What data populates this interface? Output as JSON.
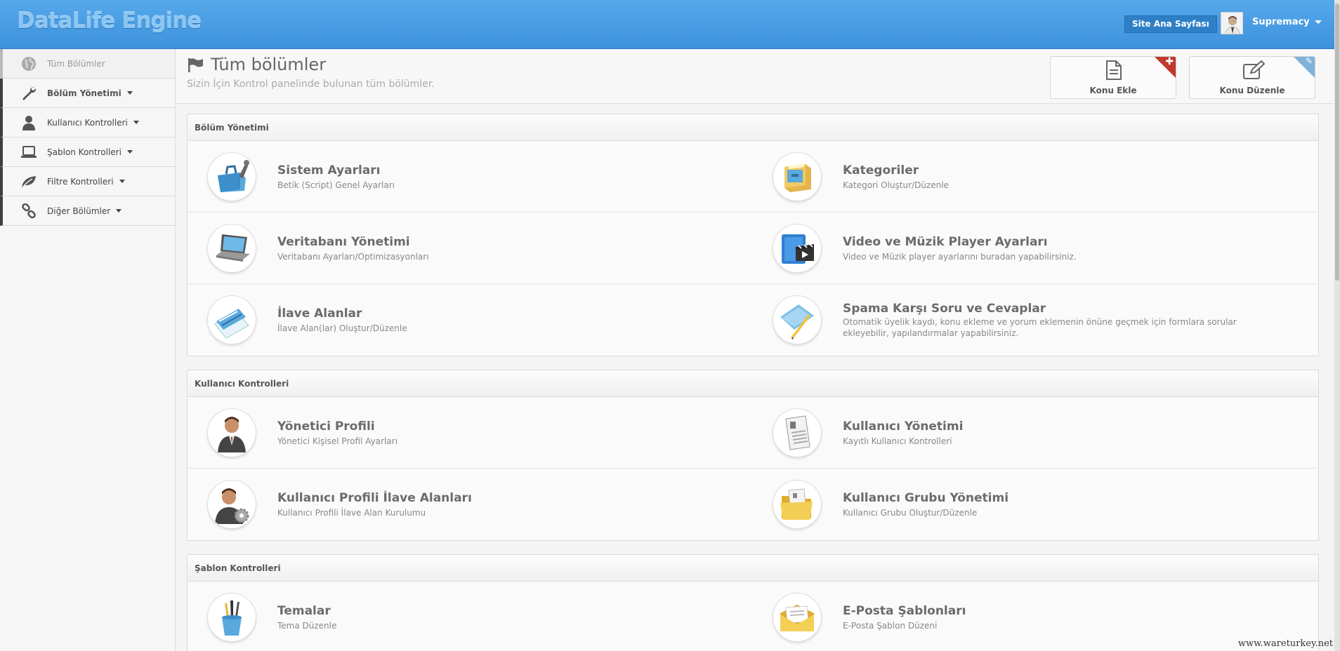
{
  "header": {
    "logo": "DataLife Engine",
    "site_button": "Site Ana Sayfası",
    "user_name": "Supremacy"
  },
  "sidebar": {
    "items": [
      {
        "label": "Tüm Bölümler",
        "icon": "globe-icon",
        "active": true
      },
      {
        "label": "Bölüm Yönetimi",
        "icon": "wrench-icon"
      },
      {
        "label": "Kullanıcı Kontrolleri",
        "icon": "user-icon"
      },
      {
        "label": "Şablon Kontrolleri",
        "icon": "laptop-icon"
      },
      {
        "label": "Filtre Kontrolleri",
        "icon": "leaf-icon"
      },
      {
        "label": "Diğer Bölümler",
        "icon": "link-icon"
      }
    ]
  },
  "page": {
    "title": "Tüm bölümler",
    "subtitle": "Sizin İçin Kontrol panelinde bulunan tüm bölümler."
  },
  "quick_buttons": [
    {
      "label": "Konu Ekle",
      "icon": "document-icon",
      "corner_color": "#c0392b"
    },
    {
      "label": "Konu Düzenle",
      "icon": "edit-icon",
      "corner_color": "#7fb3d9"
    }
  ],
  "panels": [
    {
      "title": "Bölüm Yönetimi",
      "items": [
        {
          "title": "Sistem Ayarları",
          "desc": "Betik (Script) Genel Ayarları",
          "icon": "toolbox-icon"
        },
        {
          "title": "Kategoriler",
          "desc": "Kategori Oluştur/Düzenle",
          "icon": "filing-cabinet-icon"
        },
        {
          "title": "Veritabanı Yönetimi",
          "desc": "Veritabanı Ayarları/Optimizasyonları",
          "icon": "laptop-icon"
        },
        {
          "title": "Video ve Müzik Player Ayarları",
          "desc": "Video ve Müzik player ayarlarını buradan yapabilirsiniz.",
          "icon": "video-icon"
        },
        {
          "title": "İlave Alanlar",
          "desc": "İlave Alan(lar) Oluştur/Düzenle",
          "icon": "ruler-icon"
        },
        {
          "title": "Spama Karşı Soru ve Cevaplar",
          "desc": "Otomatik üyelik kaydı, konu ekleme ve yorum eklemenin önüne geçmek için formlara sorular ekleyebilir, yapılandırmalar yapabilirsiniz.",
          "icon": "paper-pencil-icon"
        }
      ]
    },
    {
      "title": "Kullanıcı Kontrolleri",
      "items": [
        {
          "title": "Yönetici Profili",
          "desc": "Yönetici Kişisel Profil Ayarları",
          "icon": "admin-user-icon"
        },
        {
          "title": "Kullanıcı Yönetimi",
          "desc": "Kayıtlı Kullanıcı Kontrolleri",
          "icon": "document-list-icon"
        },
        {
          "title": "Kullanıcı Profili İlave Alanları",
          "desc": "Kullanıcı Profili İlave Alan Kurulumu",
          "icon": "user-gear-icon"
        },
        {
          "title": "Kullanıcı Grubu Yönetimi",
          "desc": "Kullanıcı Grubu Oluştur/Düzenle",
          "icon": "folder-icon"
        }
      ]
    },
    {
      "title": "Şablon Kontrolleri",
      "items": [
        {
          "title": "Temalar",
          "desc": "Tema Düzenle",
          "icon": "pencil-cup-icon"
        },
        {
          "title": "E-Posta Şablonları",
          "desc": "E-Posta Şablon Düzeni",
          "icon": "envelope-icon"
        }
      ]
    }
  ],
  "watermark": "www.wareturkey.net"
}
